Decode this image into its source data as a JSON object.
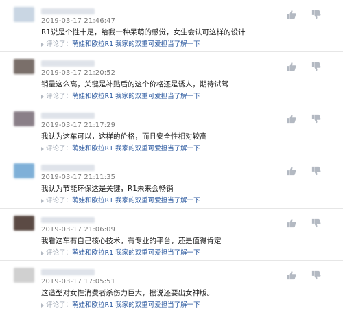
{
  "comments": [
    {
      "date": "2019-03-17 21:46:47",
      "text": "R1说是个性十足，给我一种呆萌的感觉，女生会认可这样的设计",
      "sub_prefix": "评论了：",
      "sub_link": "萌娃和欧拉R1 我家的双重可爱担当了解一下",
      "avatar_color": "#c9d6e3"
    },
    {
      "date": "2019-03-17 21:20:52",
      "text": "销量这么高，关键是补贴后的这个价格还是诱人，期待试驾",
      "sub_prefix": "评论了：",
      "sub_link": "萌娃和欧拉R1 我家的双重可爱担当了解一下",
      "avatar_color": "#7a6f6a"
    },
    {
      "date": "2019-03-17 21:17:29",
      "text": "我认为这车可以，这样的价格，而且安全性相对较高",
      "sub_prefix": "评论了：",
      "sub_link": "萌娃和欧拉R1 我家的双重可爱担当了解一下",
      "avatar_color": "#8a7f88"
    },
    {
      "date": "2019-03-17 21:11:35",
      "text": "我认为节能环保这是关键，R1未来会畅销",
      "sub_prefix": "评论了：",
      "sub_link": "萌娃和欧拉R1 我家的双重可爱担当了解一下",
      "avatar_color": "#7fb0d8"
    },
    {
      "date": "2019-03-17 21:06:09",
      "text": "我看这车有自己核心技术，有专业的平台，还是值得肯定",
      "sub_prefix": "评论了：",
      "sub_link": "萌娃和欧拉R1 我家的双重可爱担当了解一下",
      "avatar_color": "#5b4a44"
    },
    {
      "date": "2019-03-17 17:05:51",
      "text": "这造型对女性消费者杀伤力巨大，据说还要出女神版。",
      "sub_prefix": "评论了：",
      "sub_link": "萌娃和欧拉R1 我家的双重可爱担当了解一下",
      "avatar_color": "#d0d0d0"
    }
  ],
  "icons": {
    "like": "thumbs-up-icon",
    "dislike": "thumbs-down-icon"
  },
  "colors": {
    "link": "#2c5aa0",
    "divider": "#e6e6e6",
    "icon": "#b3b9c2"
  }
}
